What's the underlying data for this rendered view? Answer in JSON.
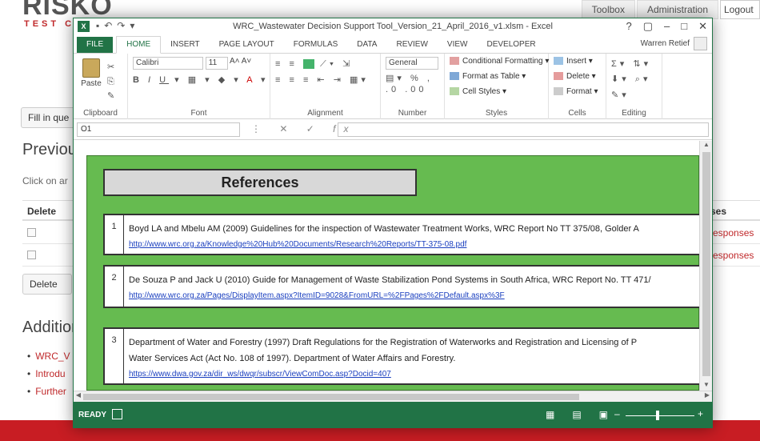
{
  "website": {
    "logo": "RISKO",
    "logo_sub": "TEST C",
    "nav": [
      "Toolbox",
      "Administration",
      "Logout"
    ],
    "fill_button": "Fill in que",
    "previous_heading": "Previous",
    "click_text": "Click on ar",
    "table": {
      "col_delete": "Delete",
      "col_responses": "ses",
      "rows": [
        {
          "responses_link": "esponses"
        },
        {
          "responses_link": "esponses"
        }
      ]
    },
    "delete_button": "Delete",
    "additional_heading": "Addition",
    "additional_links": [
      "WRC_V",
      "Introdu",
      "Further"
    ],
    "colors": {
      "brand_red": "#c81d23"
    }
  },
  "excel": {
    "title": "WRC_Wastewater Decision Support Tool_Version_21_April_2016_v1.xlsm - Excel",
    "window_controls": [
      "?",
      "▢",
      "–",
      "□",
      "✕"
    ],
    "tabs": [
      "FILE",
      "HOME",
      "INSERT",
      "PAGE LAYOUT",
      "FORMULAS",
      "DATA",
      "REVIEW",
      "VIEW",
      "DEVELOPER"
    ],
    "active_tab": "HOME",
    "user": "Warren Retief",
    "ribbon": {
      "clipboard": {
        "paste": "Paste",
        "label": "Clipboard"
      },
      "font": {
        "font_name": "Calibri",
        "font_size": "11",
        "label": "Font"
      },
      "alignment": {
        "label": "Alignment"
      },
      "number": {
        "format": "General",
        "percent": "% ,",
        "label": "Number"
      },
      "styles": {
        "items": [
          "Conditional Formatting",
          "Format as Table",
          "Cell Styles"
        ],
        "label": "Styles"
      },
      "cells": {
        "items": [
          "Insert",
          "Delete",
          "Format"
        ],
        "label": "Cells"
      },
      "editing": {
        "label": "Editing"
      }
    },
    "formula_bar": {
      "name_box": "O1",
      "fx": "fx",
      "value": ""
    },
    "sheet": {
      "header": "References",
      "references": [
        {
          "num": "1",
          "text": "Boyd LA and Mbelu AM (2009) Guidelines for the inspection of Wastewater Treatment Works, WRC Report No TT 375/08, Golder A",
          "link": "http://www.wrc.org.za/Knowledge%20Hub%20Documents/Research%20Reports/TT-375-08.pdf"
        },
        {
          "num": "2",
          "text": "De Souza P and Jack U (2010) Guide for Management of Waste Stabilization Pond Systems in South Africa, WRC Report No. TT 471/",
          "link": "http://www.wrc.org.za/Pages/DisplayItem.aspx?ItemID=9028&FromURL=%2FPages%2FDefault.aspx%3F"
        },
        {
          "num": "3",
          "text": "Department of Water and Forestry (1997) Draft Regulations for the Registration of Waterworks and Registration and Licensing of P",
          "text2": "Water Services Act (Act No. 108 of 1997). Department of Water Affairs and Forestry.",
          "link": "https://www.dwa.gov.za/dir_ws/dwqr/subscr/ViewComDoc.asp?Docid=407"
        }
      ]
    },
    "status": {
      "ready": "READY"
    },
    "colors": {
      "excel_green": "#217346",
      "panel_green": "#66bb50",
      "link_blue": "#1a3fbf"
    }
  }
}
